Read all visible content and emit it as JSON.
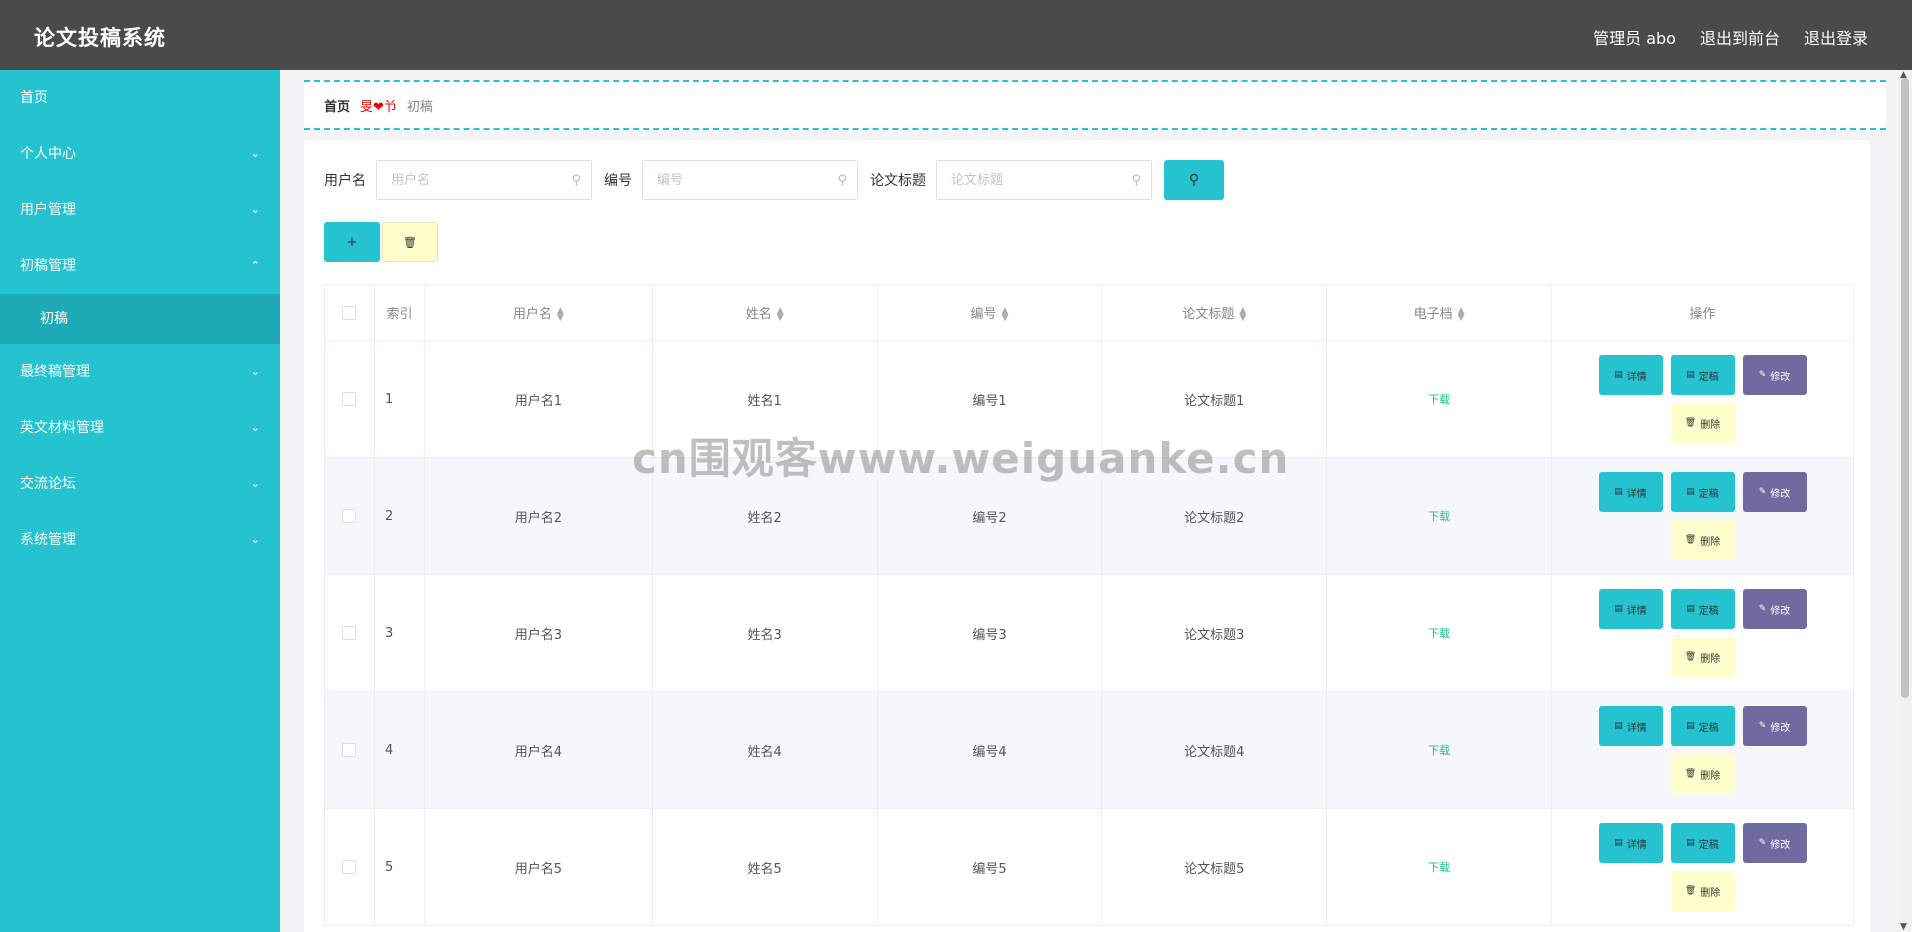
{
  "header": {
    "title": "论文投稿系统",
    "user_label": "管理员 abo",
    "front_label": "退出到前台",
    "logout_label": "退出登录"
  },
  "sidebar": {
    "items": [
      {
        "label": "首页",
        "has_chevron": false
      },
      {
        "label": "个人中心",
        "has_chevron": true,
        "chevron": "chevron-down-icon"
      },
      {
        "label": "用户管理",
        "has_chevron": true,
        "chevron": "chevron-down-icon"
      },
      {
        "label": "初稿管理",
        "has_chevron": true,
        "chevron": "chevron-up-icon"
      },
      {
        "label": "初稿",
        "sub": true
      },
      {
        "label": "最终稿管理",
        "has_chevron": true,
        "chevron": "chevron-down-icon"
      },
      {
        "label": "英文材料管理",
        "has_chevron": true,
        "chevron": "chevron-down-icon"
      },
      {
        "label": "交流论坛",
        "has_chevron": true,
        "chevron": "chevron-down-icon"
      },
      {
        "label": "系统管理",
        "has_chevron": true,
        "chevron": "chevron-down-icon"
      }
    ]
  },
  "breadcrumb": {
    "home": "首页",
    "separator": "旻❤兯",
    "current": "初稿"
  },
  "search": {
    "username_label": "用户名",
    "username_placeholder": "用户名",
    "number_label": "编号",
    "number_placeholder": "编号",
    "title_label": "论文标题",
    "title_placeholder": "论文标题"
  },
  "table": {
    "headers": [
      "索引",
      "用户名",
      "姓名",
      "编号",
      "论文标题",
      "电子档",
      "操作"
    ],
    "rows": [
      {
        "index": "1",
        "username": "用户名1",
        "name": "姓名1",
        "number": "编号1",
        "title": "论文标题1",
        "file": "下载"
      },
      {
        "index": "2",
        "username": "用户名2",
        "name": "姓名2",
        "number": "编号2",
        "title": "论文标题2",
        "file": "下载"
      },
      {
        "index": "3",
        "username": "用户名3",
        "name": "姓名3",
        "number": "编号3",
        "title": "论文标题3",
        "file": "下载"
      },
      {
        "index": "4",
        "username": "用户名4",
        "name": "姓名4",
        "number": "编号4",
        "title": "论文标题4",
        "file": "下载"
      },
      {
        "index": "5",
        "username": "用户名5",
        "name": "姓名5",
        "number": "编号5",
        "title": "论文标题5",
        "file": "下载"
      }
    ],
    "actions": {
      "detail": "详情",
      "final": "定稿",
      "edit": "修改",
      "delete": "删除"
    }
  },
  "watermark": "cn围观客www.weiguanke.cn",
  "colors": {
    "topbar": "#4a4a4a",
    "accent": "#25c2cf",
    "sidebar_active": "#1eabb7",
    "edit_button": "#6f6aa0",
    "delete_button": "#ffffcc",
    "download_link": "#1fbf8f"
  }
}
